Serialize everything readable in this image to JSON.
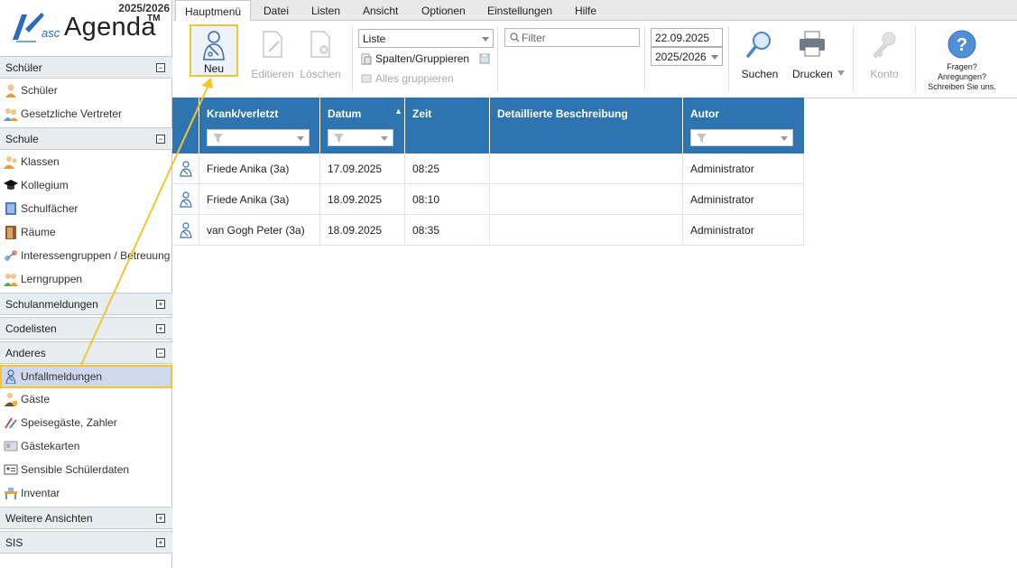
{
  "logo": {
    "year": "2025/2026",
    "prefix": "asc",
    "name": "Agenda",
    "tm": "TM"
  },
  "sidebar": {
    "sections": [
      {
        "title": "Schüler",
        "toggle": "−"
      },
      {
        "title": "Schule",
        "toggle": "−"
      },
      {
        "title": "Schulanmeldungen",
        "toggle": "+"
      },
      {
        "title": "Codelisten",
        "toggle": "+"
      },
      {
        "title": "Anderes",
        "toggle": "−"
      },
      {
        "title": "Weitere Ansichten",
        "toggle": "+"
      },
      {
        "title": "SIS",
        "toggle": "+"
      }
    ],
    "items": [
      {
        "label": "Schüler",
        "icon": "student-icon"
      },
      {
        "label": "Gesetzliche Vertreter",
        "icon": "parents-icon"
      },
      {
        "label": "Klassen",
        "icon": "class-icon"
      },
      {
        "label": "Kollegium",
        "icon": "graduation-cap-icon"
      },
      {
        "label": "Schulfächer",
        "icon": "book-icon"
      },
      {
        "label": "Räume",
        "icon": "door-icon"
      },
      {
        "label": "Interessengruppen / Betreuung",
        "icon": "interest-groups-icon"
      },
      {
        "label": "Lerngruppen",
        "icon": "learning-groups-icon"
      },
      {
        "label": "Unfallmeldungen",
        "icon": "injured-person-icon"
      },
      {
        "label": "Gäste",
        "icon": "guest-icon"
      },
      {
        "label": "Speisegäste, Zahler",
        "icon": "meal-icon"
      },
      {
        "label": "Gästekarten",
        "icon": "guest-card-icon"
      },
      {
        "label": "Sensible Schülerdaten",
        "icon": "id-card-icon"
      },
      {
        "label": "Inventar",
        "icon": "desk-icon"
      }
    ]
  },
  "menu": {
    "tabs": [
      "Hauptmenü",
      "Datei",
      "Listen",
      "Ansicht",
      "Optionen",
      "Einstellungen",
      "Hilfe"
    ],
    "active": 0
  },
  "toolbar": {
    "new_label": "Neu",
    "edit_label": "Editieren",
    "delete_label": "Löschen",
    "view_select": "Liste",
    "columns_label": "Spalten/Gruppieren",
    "group_all_label": "Alles gruppieren",
    "filter_placeholder": "Filter",
    "date_value": "22.09.2025",
    "year_select": "2025/2026",
    "search_label": "Suchen",
    "print_label": "Drucken",
    "account_label": "Konto",
    "help_line1": "Fragen?",
    "help_line2": "Anregungen?",
    "help_line3": "Schreiben Sie uns."
  },
  "table": {
    "columns": [
      "Krank/verletzt",
      "Datum",
      "Zeit",
      "Detaillierte Beschreibung",
      "Autor"
    ],
    "sort_indicator": "▲",
    "rows": [
      {
        "name": "Friede Anika (3a)",
        "date": "17.09.2025",
        "time": "08:25",
        "description": "",
        "author": "Administrator"
      },
      {
        "name": "Friede Anika (3a)",
        "date": "18.09.2025",
        "time": "08:10",
        "description": "",
        "author": "Administrator"
      },
      {
        "name": "van Gogh Peter (3a)",
        "date": "18.09.2025",
        "time": "08:35",
        "description": "",
        "author": "Administrator"
      }
    ]
  },
  "colors": {
    "header_blue": "#2e74b0",
    "highlight_yellow": "#f2c531",
    "selected_bg": "#cfd8ec",
    "icon_blue": "#3a6fb0"
  }
}
